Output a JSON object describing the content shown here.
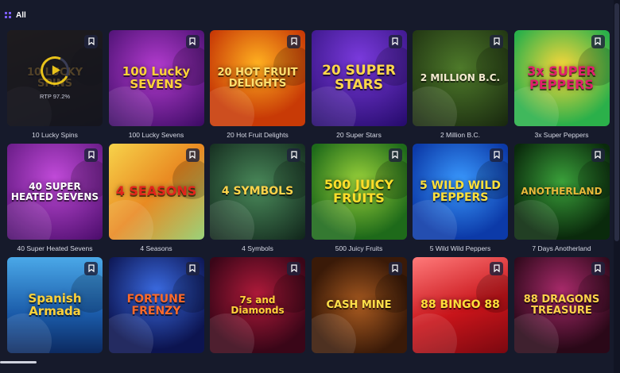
{
  "header": {
    "title": "All",
    "icon": "grid-icon"
  },
  "colors": {
    "background": "#161a2b",
    "accent": "#7a5cff",
    "play_ring": "#e8c21a"
  },
  "overlay": {
    "rtp": "RTP 97.2%"
  },
  "games": [
    {
      "caption": "10 Lucky Spins",
      "title": "10 LUCKY SPINS",
      "bg": "linear-gradient(160deg,#3a2a10,#1a1410)",
      "fg": "#f0b030",
      "size": 13
    },
    {
      "caption": "100 Lucky Sevens",
      "title": "100 Lucky SEVENS",
      "bg": "radial-gradient(circle at 50% 40%,#b43cd0,#3a0a62)",
      "fg": "#ffd23a",
      "size": 15
    },
    {
      "caption": "20 Hot Fruit Delights",
      "title": "20 HOT FRUIT DELIGHTS",
      "bg": "radial-gradient(circle at 50% 35%,#ffb020,#c83a06 70%)",
      "fg": "#ffe070",
      "size": 13
    },
    {
      "caption": "20 Super Stars",
      "title": "20 SUPER STARS",
      "bg": "radial-gradient(circle at 50% 30%,#7a3adc,#240a6a)",
      "fg": "#ffd84a",
      "size": 17
    },
    {
      "caption": "2 Million B.C.",
      "title": "2 MILLION B.C.",
      "bg": "radial-gradient(circle at 50% 40%,#4e7a2a,#17260e)",
      "fg": "#f4ead0",
      "size": 12
    },
    {
      "caption": "3x Super Peppers",
      "title": "3x SUPER PEPPERS",
      "bg": "radial-gradient(circle at 50% 40%,#ffd83a,#2bb04a 75%)",
      "fg": "#e01e6e",
      "size": 16
    },
    {
      "caption": "40 Super Heated Sevens",
      "title": "40 SUPER HEATED SEVENS",
      "bg": "radial-gradient(circle at 50% 35%,#c04ad8,#4a0c6a)",
      "fg": "#ffffff",
      "size": 12
    },
    {
      "caption": "4 Seasons",
      "title": "4 SEASONS",
      "bg": "linear-gradient(135deg,#f7d34a,#e98a22 50%,#9ad27a)",
      "fg": "#e3241c",
      "size": 16
    },
    {
      "caption": "4 Symbols",
      "title": "4 SYMBOLS",
      "bg": "radial-gradient(circle at 50% 45%,#4a8a5a,#10241a)",
      "fg": "#ffd34a",
      "size": 14
    },
    {
      "caption": "500 Juicy Fruits",
      "title": "500 JUICY FRUITS",
      "bg": "radial-gradient(circle at 50% 40%,#9ad23a,#1e6a1a 75%)",
      "fg": "#ffde2a",
      "size": 16
    },
    {
      "caption": "5 Wild Wild Peppers",
      "title": "5 WILD WILD PEPPERS",
      "bg": "radial-gradient(circle at 50% 40%,#3a9aff,#0c3aa8 75%)",
      "fg": "#ffe13a",
      "size": 14
    },
    {
      "caption": "7 Days Anotherland",
      "title": "ANOTHERLAND",
      "bg": "radial-gradient(circle at 50% 40%,#3aa03a,#0a2a0c 75%)",
      "fg": "#e8b83a",
      "size": 12
    },
    {
      "caption": "",
      "title": "Spanish Armada",
      "bg": "linear-gradient(180deg,#4aa8e8,#1a5aa8 60%,#0c2a60)",
      "fg": "#ffd23a",
      "size": 15
    },
    {
      "caption": "",
      "title": "FORTUNE FRENZY",
      "bg": "radial-gradient(circle at 50% 35%,#3a6ae0,#0c1450 75%)",
      "fg": "#ff6a2a",
      "size": 14
    },
    {
      "caption": "",
      "title": "7s and Diamonds",
      "bg": "radial-gradient(circle at 50% 40%,#b01a3a,#3a0618 75%)",
      "fg": "#ffd23a",
      "size": 12
    },
    {
      "caption": "",
      "title": "CASH MINE",
      "bg": "radial-gradient(circle at 50% 50%,#a85a20,#3a1a08 75%)",
      "fg": "#ffe04a",
      "size": 13
    },
    {
      "caption": "",
      "title": "88 BINGO 88",
      "bg": "linear-gradient(160deg,#ff7a7a,#c8141a 55%,#7a0810)",
      "fg": "#ffde3a",
      "size": 14
    },
    {
      "caption": "",
      "title": "88 DRAGONS TREASURE",
      "bg": "radial-gradient(circle at 50% 35%,#a82a6a,#2a0818 75%)",
      "fg": "#ffd34a",
      "size": 13
    }
  ]
}
